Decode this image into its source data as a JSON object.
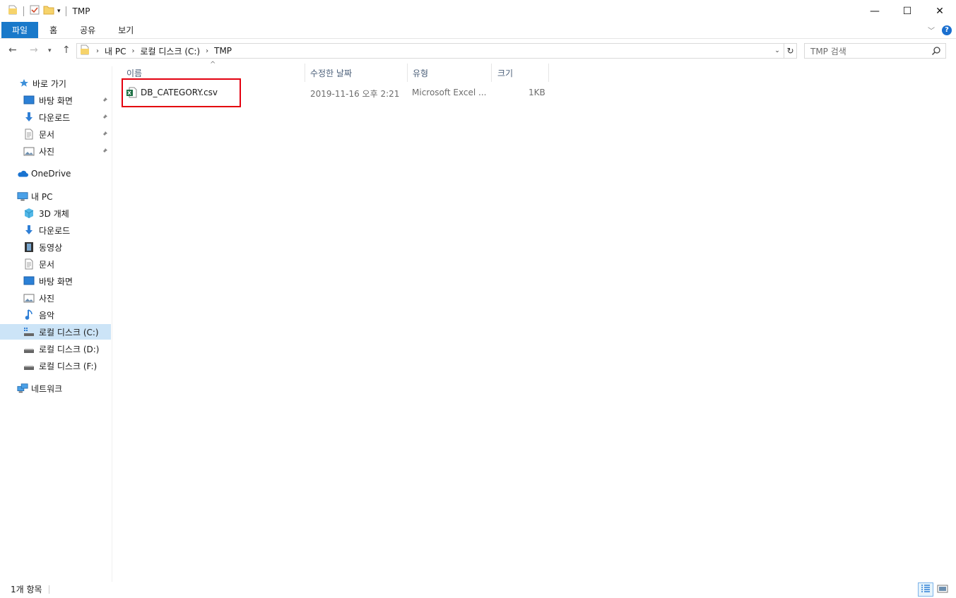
{
  "window": {
    "title": "TMP",
    "minimize": "—",
    "maximize": "☐",
    "close": "✕"
  },
  "ribbon": {
    "tabs": [
      "파일",
      "홈",
      "공유",
      "보기"
    ],
    "help": "?"
  },
  "address": {
    "crumbs": [
      "내 PC",
      "로컬 디스크 (C:)",
      "TMP"
    ],
    "search_placeholder": "TMP 검색"
  },
  "sidebar": {
    "quick_access": "바로 가기",
    "quick_items": [
      "바탕 화면",
      "다운로드",
      "문서",
      "사진"
    ],
    "onedrive": "OneDrive",
    "this_pc": "내 PC",
    "pc_items": [
      "3D 개체",
      "다운로드",
      "동영상",
      "문서",
      "바탕 화면",
      "사진",
      "음악",
      "로컬 디스크 (C:)",
      "로컬 디스크 (D:)",
      "로컬 디스크 (F:)"
    ],
    "network": "네트워크",
    "selected": "로컬 디스크 (C:)"
  },
  "columns": [
    "이름",
    "수정한 날짜",
    "유형",
    "크기"
  ],
  "files": [
    {
      "name": "DB_CATEGORY.csv",
      "modified": "2019-11-16 오후 2:21",
      "type": "Microsoft Excel ...",
      "size": "1KB"
    }
  ],
  "status": {
    "count": "1개 항목"
  },
  "colors": {
    "file_tab": "#1979ca",
    "selected_nav": "#cce4f7",
    "highlight_box": "#e3000f",
    "excel_green": "#1e7145"
  }
}
